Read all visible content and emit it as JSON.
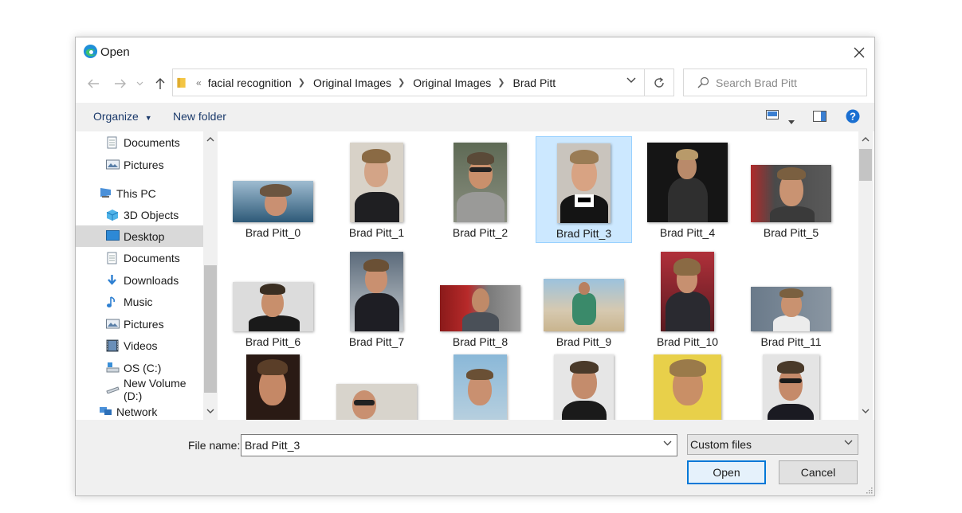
{
  "window": {
    "title": "Open"
  },
  "nav": {
    "breadcrumb_prefix": "«",
    "breadcrumbs": [
      "facial recognition",
      "Original Images",
      "Original Images",
      "Brad Pitt"
    ],
    "search_placeholder": "Search Brad Pitt"
  },
  "toolbar": {
    "organize_label": "Organize",
    "new_folder_label": "New folder"
  },
  "sidebar": {
    "items": [
      {
        "label": "Documents",
        "icon": "documents-icon"
      },
      {
        "label": "Pictures",
        "icon": "pictures-icon"
      },
      {
        "label": "This PC",
        "icon": "this-pc-icon"
      },
      {
        "label": "3D Objects",
        "icon": "3d-objects-icon"
      },
      {
        "label": "Desktop",
        "icon": "desktop-icon",
        "selected": true
      },
      {
        "label": "Documents",
        "icon": "documents-icon"
      },
      {
        "label": "Downloads",
        "icon": "downloads-icon"
      },
      {
        "label": "Music",
        "icon": "music-icon"
      },
      {
        "label": "Pictures",
        "icon": "pictures-icon"
      },
      {
        "label": "Videos",
        "icon": "videos-icon"
      },
      {
        "label": "OS (C:)",
        "icon": "drive-c-icon"
      },
      {
        "label": "New Volume (D:)",
        "icon": "drive-d-icon"
      },
      {
        "label": "Network",
        "icon": "network-icon"
      }
    ]
  },
  "files": [
    {
      "name": "Brad Pitt_0"
    },
    {
      "name": "Brad Pitt_1"
    },
    {
      "name": "Brad Pitt_2"
    },
    {
      "name": "Brad Pitt_3",
      "selected": true
    },
    {
      "name": "Brad Pitt_4"
    },
    {
      "name": "Brad Pitt_5"
    },
    {
      "name": "Brad Pitt_6"
    },
    {
      "name": "Brad Pitt_7"
    },
    {
      "name": "Brad Pitt_8"
    },
    {
      "name": "Brad Pitt_9"
    },
    {
      "name": "Brad Pitt_10"
    },
    {
      "name": "Brad Pitt_11"
    },
    {
      "name": ""
    },
    {
      "name": ""
    },
    {
      "name": ""
    },
    {
      "name": ""
    },
    {
      "name": ""
    },
    {
      "name": ""
    }
  ],
  "footer": {
    "filename_label": "File name:",
    "filename_value": "Brad Pitt_3",
    "filetype_value": "Custom files",
    "open_label": "Open",
    "cancel_label": "Cancel"
  },
  "colors": {
    "accent": "#0078d7",
    "selection": "#cce8ff",
    "link_text": "#1b3a6b",
    "help": "#1a6fd1"
  }
}
